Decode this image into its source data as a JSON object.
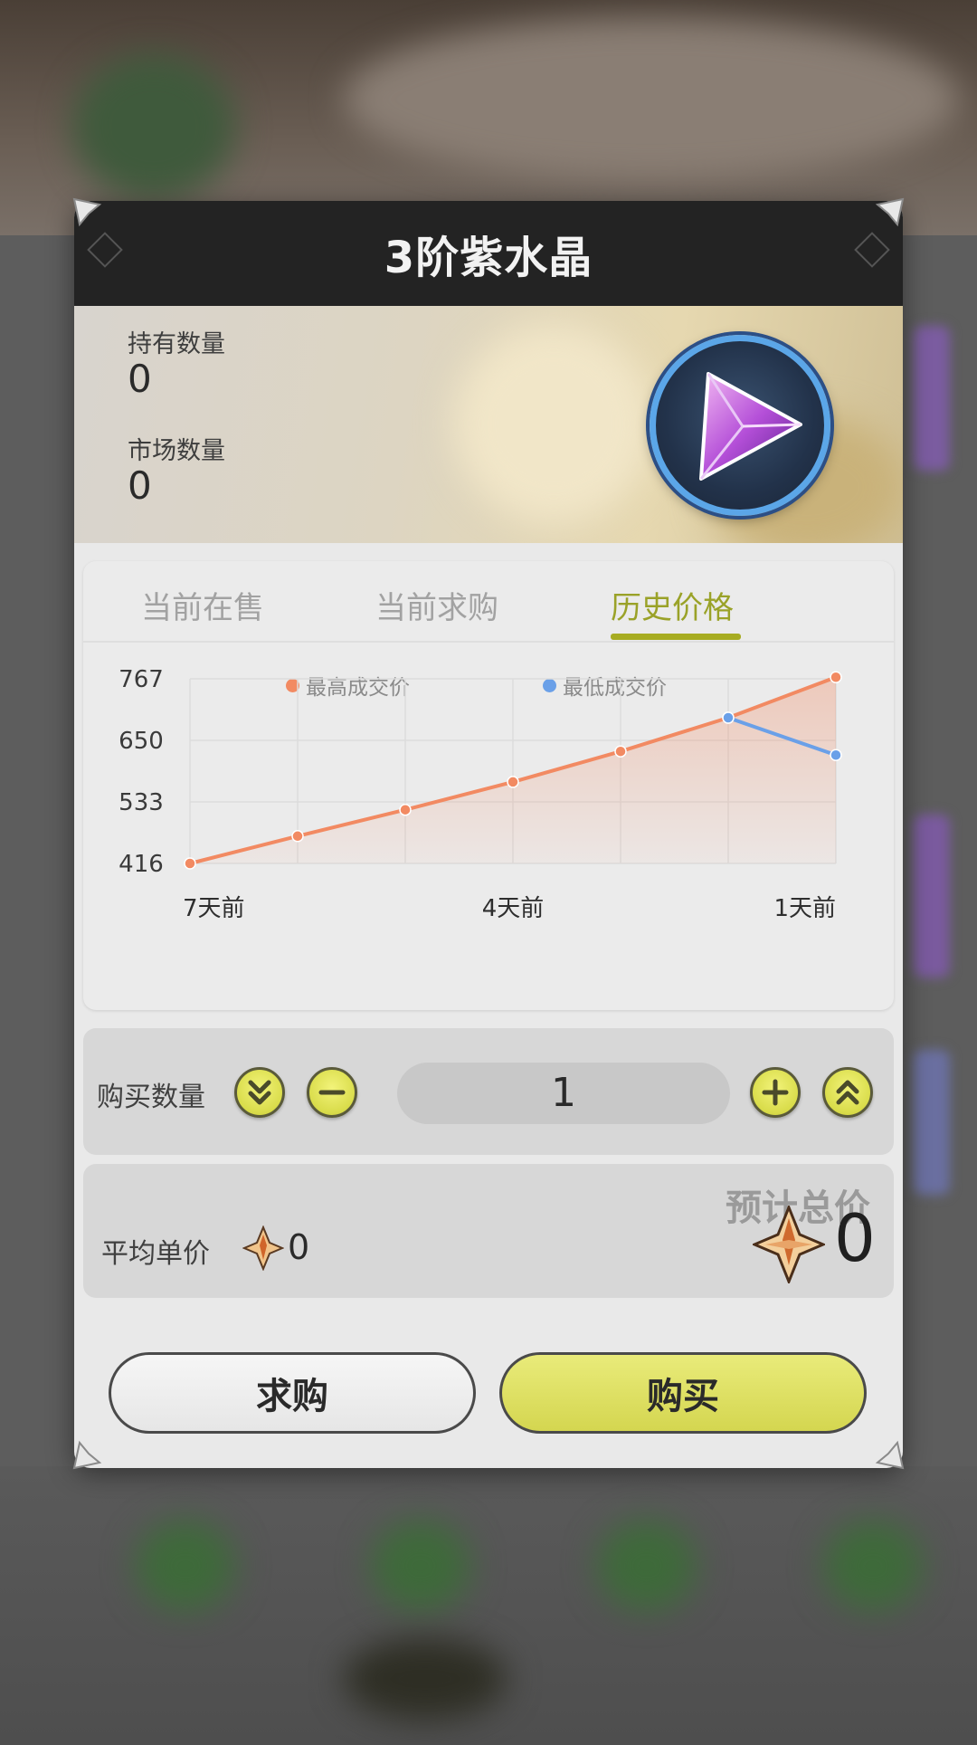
{
  "dialog": {
    "title": "3阶紫水晶"
  },
  "stats": {
    "held_label": "持有数量",
    "held_value": "0",
    "market_label": "市场数量",
    "market_value": "0"
  },
  "tabs": [
    {
      "label": "当前在售",
      "active": false
    },
    {
      "label": "当前求购",
      "active": false
    },
    {
      "label": "历史价格",
      "active": true
    }
  ],
  "chart_data": {
    "type": "line",
    "x": [
      "7天前",
      "6天前",
      "5天前",
      "4天前",
      "3天前",
      "2天前",
      "1天前"
    ],
    "x_tick_labels": [
      "7天前",
      "4天前",
      "1天前"
    ],
    "y_tick_labels": [
      "767",
      "650",
      "533",
      "416"
    ],
    "ylim": [
      416,
      767
    ],
    "grid": true,
    "legend_position": "top-center",
    "series": [
      {
        "name": "最高成交价",
        "color": "#f28a62",
        "values": [
          416,
          468,
          518,
          571,
          629,
          693,
          770
        ]
      },
      {
        "name": "最低成交价",
        "color": "#6aa0e8",
        "values": [
          null,
          null,
          null,
          null,
          null,
          693,
          622
        ]
      }
    ]
  },
  "quantity": {
    "label": "购买数量",
    "value": "1"
  },
  "price": {
    "avg_label": "平均单价",
    "avg_value": "0",
    "total_label": "预计总价",
    "total_value": "0"
  },
  "actions": {
    "request_label": "求购",
    "buy_label": "购买"
  },
  "colors": {
    "accent": "#a7ac22",
    "button_yellow": "#d9dc4a",
    "title_bar": "#232323"
  },
  "icons": {
    "item": "purple-crystal-icon",
    "currency": "primogem-icon"
  }
}
